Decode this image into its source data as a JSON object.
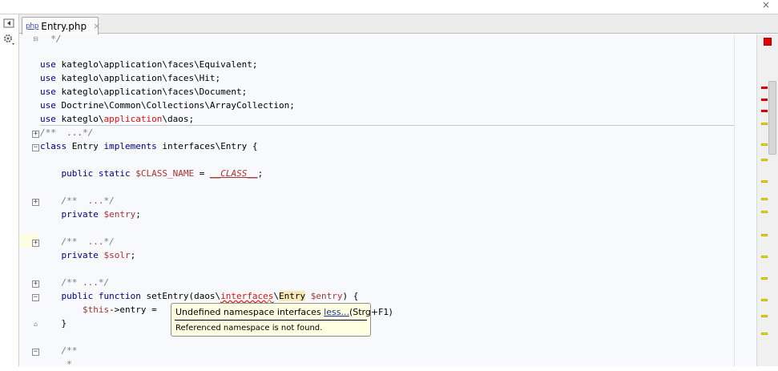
{
  "window": {
    "close_glyph": "×"
  },
  "toolstrip": {
    "icons": [
      "split-view-icon",
      "gear-icon"
    ]
  },
  "tab": {
    "icon_label": "php",
    "label": "Entry.php",
    "close_glyph": "×"
  },
  "code": {
    "comment_close": "*/",
    "use_lines": [
      {
        "kw": "use",
        "path": "kateglo\\application\\faces\\Equivalent;"
      },
      {
        "kw": "use",
        "path": "kateglo\\application\\faces\\Hit;"
      },
      {
        "kw": "use",
        "path": "kateglo\\application\\faces\\Document;"
      },
      {
        "kw": "use",
        "path": "Doctrine\\Common\\Collections\\ArrayCollection;"
      }
    ],
    "use_last": {
      "kw": "use",
      "pre": "kateglo\\",
      "err": "application",
      "post": "\\daos;"
    },
    "doc1": {
      "open": "/**",
      "dots": "...",
      "close": "*/"
    },
    "class_line": {
      "kw1": "class",
      "name": " Entry ",
      "kw2": "implements",
      "rest": " interfaces\\Entry {"
    },
    "const_line": {
      "kw": "public static",
      "var": "$CLASS_NAME",
      "eq": " = ",
      "magic": "__CLASS__",
      "semi": ";"
    },
    "doc2": {
      "open": "/**",
      "dots": "...",
      "close": "*/"
    },
    "prop1": {
      "kw": "private",
      "var": "$entry",
      "semi": ";"
    },
    "doc3": {
      "open": "/**",
      "dots": "...",
      "close": "*/"
    },
    "prop2": {
      "kw": "private",
      "var": "$solr",
      "semi": ";"
    },
    "doc4": {
      "open": "/**",
      "dots": "...",
      "close": "*/"
    },
    "func_line": {
      "kw": "public function",
      "name": " setEntry(daos\\",
      "err": "interfaces",
      "sep": "\\",
      "ref": "Entry",
      "space": " ",
      "var": "$entry",
      "rest": ") {"
    },
    "assign_line": {
      "var": "$this",
      "rest": "->entry ="
    },
    "close_brace": "}",
    "doc5_open": "/**",
    "doc5_star": "*"
  },
  "tooltip": {
    "message": "Undefined namespace interfaces",
    "link": "less...",
    "shortcut": "(Strg+F1)",
    "detail": "Referenced namespace is not found."
  },
  "colors": {
    "keyword": "#000080",
    "variable": "#aa3333",
    "error": "#e01010",
    "tooltip_bg": "#ffffe1"
  }
}
